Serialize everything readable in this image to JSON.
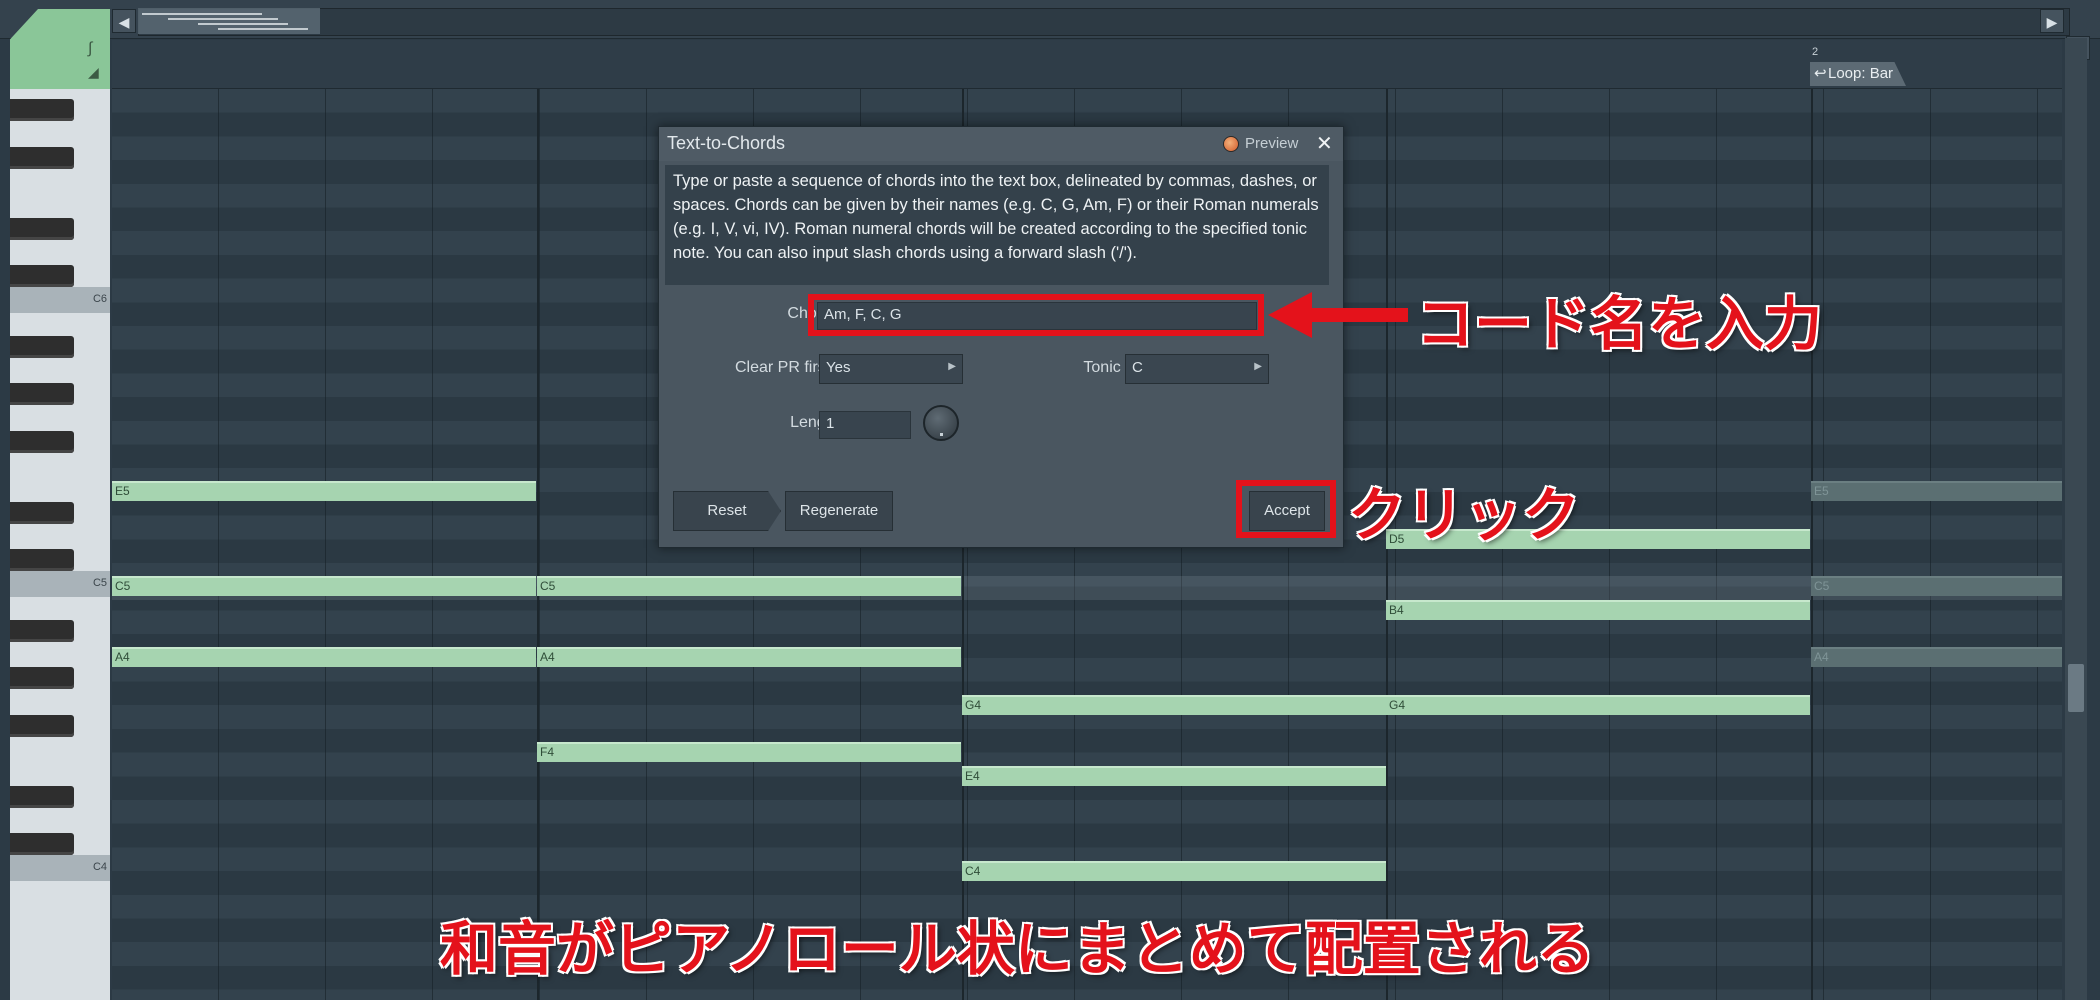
{
  "timeline": {
    "bar_number": "2",
    "loop_label": "Loop: Bar"
  },
  "keyboard": {
    "labels": [
      "C6",
      "C5",
      "C4"
    ]
  },
  "notes": [
    {
      "name": "E5"
    },
    {
      "name": "C5"
    },
    {
      "name": "A4"
    },
    {
      "name": "C5"
    },
    {
      "name": "A4"
    },
    {
      "name": "F4"
    },
    {
      "name": "G4"
    },
    {
      "name": "E4"
    },
    {
      "name": "C4"
    },
    {
      "name": "D5"
    },
    {
      "name": "B4"
    },
    {
      "name": "G4"
    },
    {
      "name": "E5"
    },
    {
      "name": "C5"
    },
    {
      "name": "A4"
    }
  ],
  "dialog": {
    "title": "Text-to-Chords",
    "preview_label": "Preview",
    "close_icon": "✕",
    "description": "Type or paste a sequence of chords into the text box, delineated by commas, dashes, or spaces. Chords can be given by their names (e.g. C, G, Am, F) or their Roman numerals (e.g. I, V, vi, IV). Roman numeral chords will be created according to the specified tonic note. You can also input slash chords using a forward slash ('/').",
    "chords_label": "Chords",
    "chords_value": "Am, F, C, G",
    "clear_label": "Clear PR first?",
    "clear_value": "Yes",
    "tonic_label": "Tonic Note",
    "tonic_value": "C",
    "length_label": "Length",
    "length_value": "1",
    "reset_label": "Reset",
    "regenerate_label": "Regenerate",
    "accept_label": "Accept"
  },
  "annotations": {
    "enter_chord": "コード名を入力",
    "click": "クリック",
    "caption": "和音がピアノロール状にまとめて配置される"
  },
  "colors": {
    "note": "#a6d4b0",
    "annotation": "#e4121b",
    "corner": "#8ac698"
  }
}
